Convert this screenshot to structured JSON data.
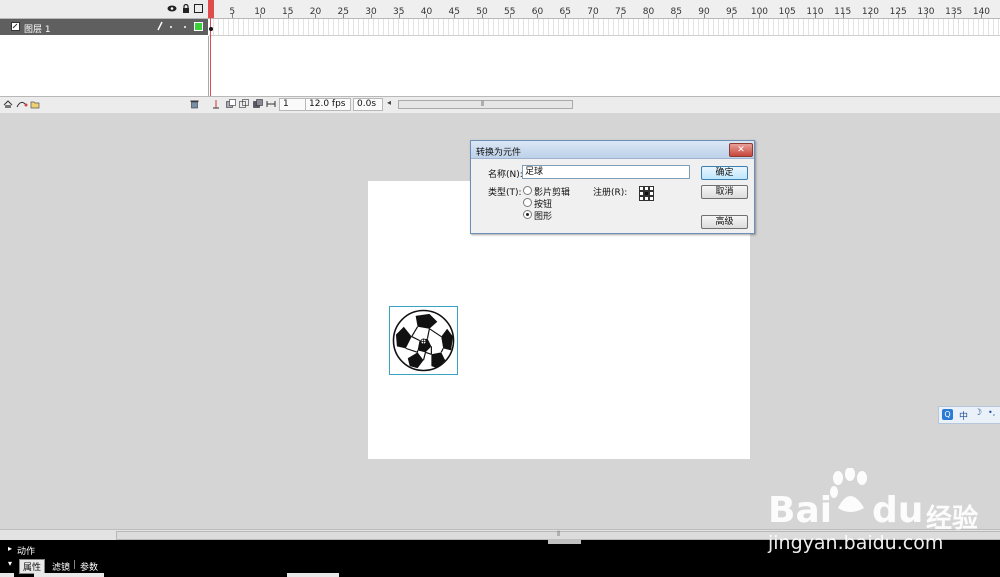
{
  "timeline": {
    "layer_name": "图层 1",
    "ruler_ticks": [
      "5",
      "10",
      "15",
      "20",
      "25",
      "30",
      "35",
      "40",
      "45",
      "50",
      "55",
      "60",
      "65",
      "70",
      "75",
      "80",
      "85",
      "90",
      "95",
      "100",
      "105",
      "110",
      "115",
      "120",
      "125",
      "130",
      "135",
      "140"
    ],
    "current_frame": "1",
    "fps": "12.0 fps",
    "elapsed": "0.0s"
  },
  "icons": {
    "eye": "eye-icon",
    "lock": "lock-icon",
    "outline": "outline-square-icon",
    "pencil": "pencil-icon",
    "trash": "trash-icon",
    "add_layer": "add-layer-icon",
    "guide_layer": "add-motion-guide-icon",
    "folder": "new-folder-icon",
    "center_frame": "center-frame-icon",
    "onion_skin": "onion-skin-icon",
    "onion_outline": "onion-skin-outline-icon",
    "edit_multiple": "edit-multiple-frames-icon",
    "modify_markers": "modify-onion-markers-icon"
  },
  "dialog": {
    "title": "转换为元件",
    "close": "✕",
    "name_label": "名称(N):",
    "name_value": "足球",
    "type_label": "类型(T):",
    "type_options": [
      "影片剪辑",
      "按钮",
      "图形"
    ],
    "selected_type": "图形",
    "registration_label": "注册(R):",
    "ok": "确定",
    "cancel": "取消",
    "advanced": "高级"
  },
  "panels": {
    "actions": "动作",
    "tabs": [
      "属性",
      "滤镜",
      "参数"
    ],
    "tab_sep": "|"
  },
  "ime": {
    "logo": "Q",
    "lang": "中",
    "moon": "☽",
    "punct": "•,"
  },
  "watermark": {
    "brand_left": "Bai",
    "brand_right": "du",
    "brand_cn": "经验",
    "url": "jingyan.baidu.com"
  },
  "colors": {
    "playhead": "#e04b4b",
    "selection": "#3aa3c2",
    "layer_row": "#5f5f5f"
  }
}
